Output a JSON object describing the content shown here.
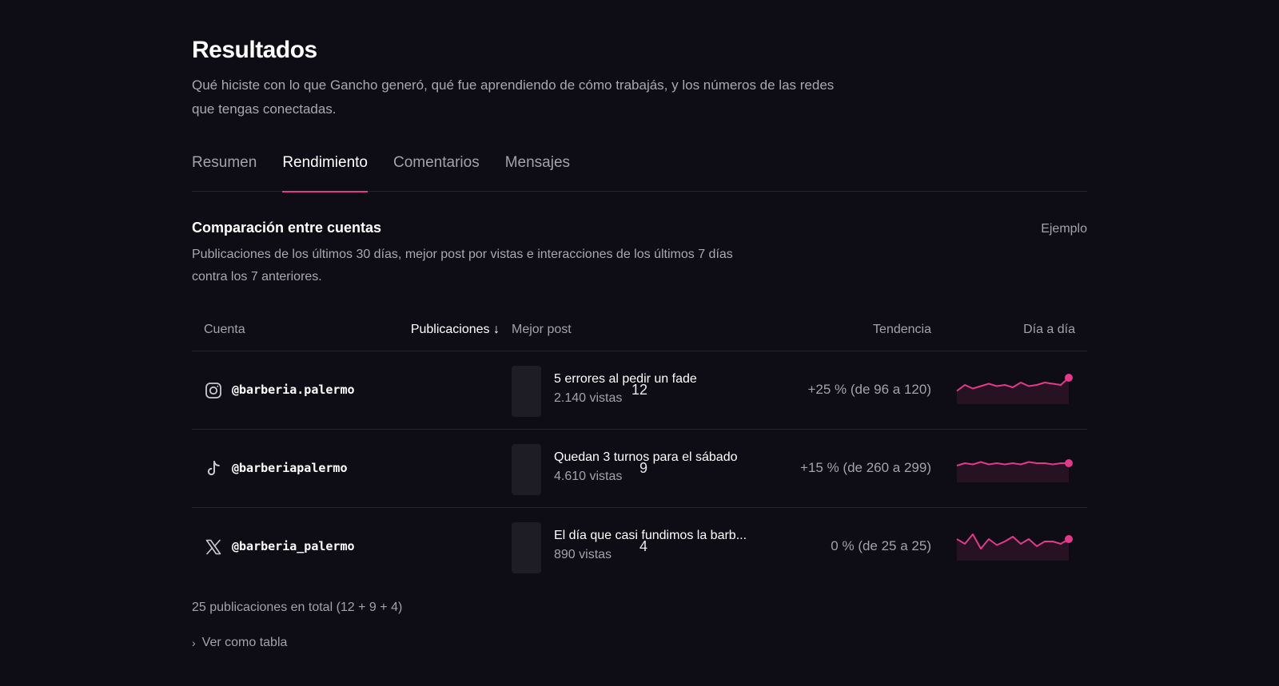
{
  "header": {
    "title": "Resultados",
    "subtitle": "Qué hiciste con lo que Gancho generó, qué fue aprendiendo de cómo trabajás, y los números de las redes que tengas conectadas."
  },
  "tabs": [
    {
      "label": "Resumen",
      "active": false
    },
    {
      "label": "Rendimiento",
      "active": true
    },
    {
      "label": "Comentarios",
      "active": false
    },
    {
      "label": "Mensajes",
      "active": false
    }
  ],
  "section": {
    "title": "Comparación entre cuentas",
    "badge": "Ejemplo",
    "description": "Publicaciones de los últimos 30 días, mejor post por vistas e interacciones de los últimos 7 días contra los 7 anteriores."
  },
  "table": {
    "columns": {
      "account": "Cuenta",
      "posts": "Publicaciones ↓",
      "best_post": "Mejor post",
      "trend": "Tendencia",
      "daily": "Día a día"
    },
    "rows": [
      {
        "network_icon": "instagram-icon",
        "handle": "@barberia.palermo",
        "posts": "12",
        "post_title": "5 errores al pedir un fade",
        "post_views": "2.140 vistas",
        "trend": "+25 % (de 96 a 120)",
        "daily": [
          7,
          12,
          9,
          11,
          13,
          11,
          12,
          10,
          14,
          11,
          12,
          14,
          13,
          12,
          18
        ]
      },
      {
        "network_icon": "tiktok-icon",
        "handle": "@barberiapalermo",
        "posts": "9",
        "post_title": "Quedan 3 turnos para el sábado",
        "post_views": "4.610 vistas",
        "trend": "+15 % (de 260 a 299)",
        "daily": [
          10,
          12,
          11,
          13,
          11,
          12,
          11,
          12,
          11,
          13,
          12,
          12,
          11,
          12,
          12
        ]
      },
      {
        "network_icon": "x-icon",
        "handle": "@barberia_palermo",
        "posts": "4",
        "post_title": "El día que casi fundimos la barb...",
        "post_views": "890 vistas",
        "trend": "0 % (de 25 a 25)",
        "daily": [
          14,
          10,
          18,
          6,
          14,
          9,
          12,
          16,
          10,
          14,
          8,
          12,
          12,
          10,
          14
        ]
      }
    ]
  },
  "footer": {
    "total_note": "25 publicaciones en total (12 + 9 + 4)",
    "toggle_label": "Ver como tabla"
  },
  "colors": {
    "background": "#0e0d15",
    "accent": "#e13a8a",
    "muted_text": "#a3a1ad",
    "divider": "#25232e"
  }
}
